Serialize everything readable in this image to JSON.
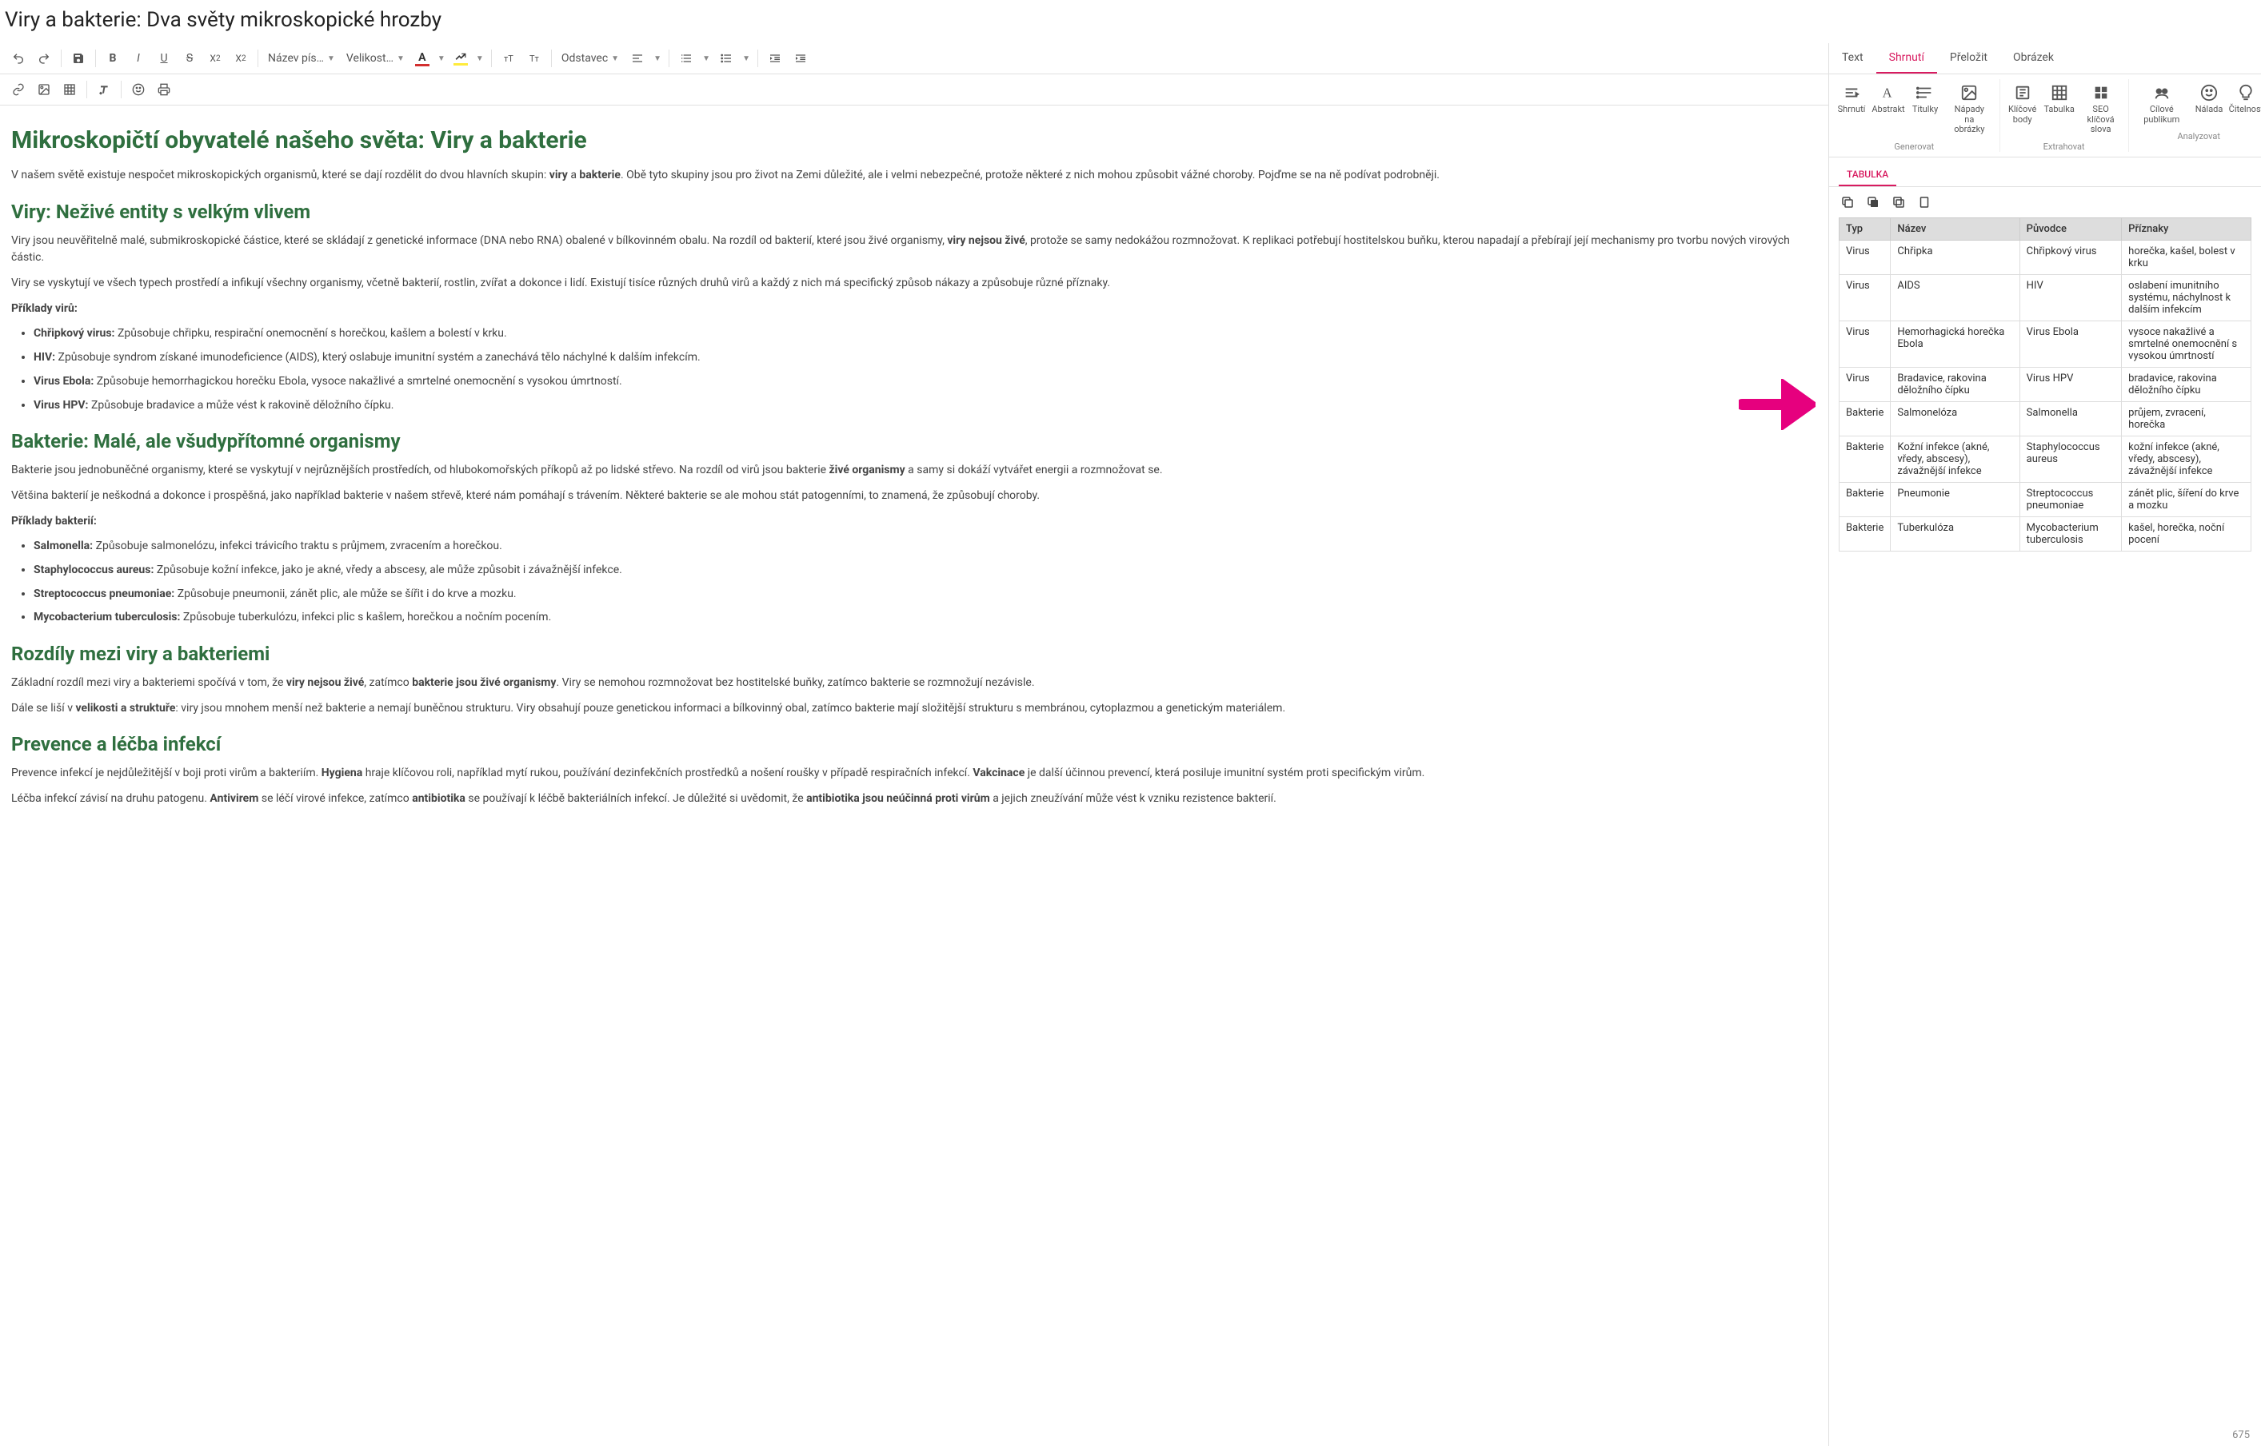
{
  "title": "Viry a bakterie: Dva světy mikroskopické hrozby",
  "toolbar": {
    "font_name": "Název pís…",
    "font_size": "Velikost…",
    "paragraph": "Odstavec"
  },
  "doc": {
    "h1": "Mikroskopičtí obyvatelé našeho světa: Viry a bakterie",
    "intro_1": "V našem světě existuje nespočet mikroskopických organismů, které se dají rozdělit do dvou hlavních skupin: ",
    "intro_b1": "viry",
    "intro_2": " a ",
    "intro_b2": "bakterie",
    "intro_3": ". Obě tyto skupiny jsou pro život na Zemi důležité, ale i velmi nebezpečné, protože některé z nich mohou způsobit vážné choroby. Pojďme se na ně podívat podrobněji.",
    "h2_viry": "Viry: Neživé entity s velkým vlivem",
    "viry_p1a": "Viry jsou neuvěřitelně malé, submikroskopické částice, které se skládají z genetické informace (DNA nebo RNA) obalené v bílkovinném obalu. Na rozdíl od bakterií, které jsou živé organismy, ",
    "viry_p1b": "viry nejsou živé",
    "viry_p1c": ", protože se samy nedokážou rozmnožovat. K replikaci potřebují hostitelskou buňku, kterou napadají a přebírají její mechanismy pro tvorbu nových virových částic.",
    "viry_p2": "Viry se vyskytují ve všech typech prostředí a infikují všechny organismy, včetně bakterií, rostlin, zvířat a dokonce i lidí. Existují tisíce různých druhů virů a každý z nich má specifický způsob nákazy a způsobuje různé příznaky.",
    "viry_ex_label": "Příklady virů:",
    "viry_list": [
      {
        "b": "Chřipkový virus:",
        "t": " Způsobuje chřipku, respirační onemocnění s horečkou, kašlem a bolestí v krku."
      },
      {
        "b": "HIV:",
        "t": " Způsobuje syndrom získané imunodeficience (AIDS), který oslabuje imunitní systém a zanechává tělo náchylné k dalším infekcím."
      },
      {
        "b": "Virus Ebola:",
        "t": " Způsobuje hemorrhagickou horečku Ebola, vysoce nakažlivé a smrtelné onemocnění s vysokou úmrtností."
      },
      {
        "b": "Virus HPV:",
        "t": " Způsobuje bradavice a může vést k rakovině děložního čípku."
      }
    ],
    "h2_bakt": "Bakterie: Malé, ale všudypřítomné organismy",
    "bakt_p1a": "Bakterie jsou jednobuněčné organismy, které se vyskytují v nejrůznějších prostředích, od hlubokomořských příkopů až po lidské střevo. Na rozdíl od virů jsou bakterie ",
    "bakt_p1b": "živé organismy",
    "bakt_p1c": " a samy si dokáží vytvářet energii a rozmnožovat se.",
    "bakt_p2": "Většina bakterií je neškodná a dokonce i prospěšná, jako například bakterie v našem střevě, které nám pomáhají s trávením. Některé bakterie se ale mohou stát patogenními, to znamená, že způsobují choroby.",
    "bakt_ex_label": "Příklady bakterií:",
    "bakt_list": [
      {
        "b": "Salmonella:",
        "t": " Způsobuje salmonelózu, infekci trávicího traktu s průjmem, zvracením a horečkou."
      },
      {
        "b": "Staphylococcus aureus:",
        "t": " Způsobuje kožní infekce, jako je akné, vředy a abscesy, ale může způsobit i závažnější infekce."
      },
      {
        "b": "Streptococcus pneumoniae:",
        "t": " Způsobuje pneumonii, zánět plic, ale může se šířit i do krve a mozku."
      },
      {
        "b": "Mycobacterium tuberculosis:",
        "t": " Způsobuje tuberkulózu, infekci plic s kašlem, horečkou a nočním pocením."
      }
    ],
    "h2_rozdily": "Rozdíly mezi viry a bakteriemi",
    "roz_p1a": "Základní rozdíl mezi viry a bakteriemi spočívá v tom, že ",
    "roz_p1b": "viry nejsou živé",
    "roz_p1c": ", zatímco ",
    "roz_p1d": "bakterie jsou živé organismy",
    "roz_p1e": ". Viry se nemohou rozmnožovat bez hostitelské buňky, zatímco bakterie se rozmnožují nezávisle.",
    "roz_p2a": "Dále se liší v ",
    "roz_p2b": "velikosti a struktuře",
    "roz_p2c": ": viry jsou mnohem menší než bakterie a nemají buněčnou strukturu. Viry obsahují pouze genetickou informaci a bílkovinný obal, zatímco bakterie mají složitější strukturu s membránou, cytoplazmou a genetickým materiálem.",
    "h2_prev": "Prevence a léčba infekcí",
    "prev_p1a": "Prevence infekcí je nejdůležitější v boji proti virům a bakteriím. ",
    "prev_p1b": "Hygiena",
    "prev_p1c": " hraje klíčovou roli, například mytí rukou, používání dezinfekčních prostředků a nošení roušky v případě respiračních infekcí. ",
    "prev_p1d": "Vakcinace",
    "prev_p1e": " je další účinnou prevencí, která posiluje imunitní systém proti specifickým virům.",
    "prev_p2a": "Léčba infekcí závisí na druhu patogenu. ",
    "prev_p2b": "Antivirem",
    "prev_p2c": " se léčí virové infekce, zatímco ",
    "prev_p2d": "antibiotika",
    "prev_p2e": " se používají k léčbě bakteriálních infekcí. Je důležité si uvědomit, že ",
    "prev_p2f": "antibiotika jsou neúčinná proti virům",
    "prev_p2g": " a jejich zneužívání může vést k vzniku rezistence bakterií."
  },
  "side": {
    "tabs": [
      "Text",
      "Shrnutí",
      "Přeložit",
      "Obrázek"
    ],
    "active_tab": 1,
    "ribbon": {
      "generate": {
        "caption": "Generovat",
        "items": [
          "Shrnutí",
          "Abstrakt",
          "Titulky",
          "Nápady na obrázky"
        ]
      },
      "extract": {
        "caption": "Extrahovat",
        "items": [
          "Klíčové body",
          "Tabulka",
          "SEO klíčová slova"
        ]
      },
      "analyze": {
        "caption": "Analyzovat",
        "items": [
          "Cílové publikum",
          "Nálada",
          "Čitelnost"
        ]
      }
    },
    "sub_tab": "TABULKA",
    "table": {
      "headers": [
        "Typ",
        "Název",
        "Původce",
        "Příznaky"
      ],
      "rows": [
        [
          "Virus",
          "Chřipka",
          "Chřipkový virus",
          "horečka, kašel, bolest v krku"
        ],
        [
          "Virus",
          "AIDS",
          "HIV",
          "oslabení imunitního systému, náchylnost k dalším infekcím"
        ],
        [
          "Virus",
          "Hemorhagická horečka Ebola",
          "Virus Ebola",
          "vysoce nakažlivé a smrtelné onemocnění s vysokou úmrtností"
        ],
        [
          "Virus",
          "Bradavice, rakovina děložního čípku",
          "Virus HPV",
          "bradavice, rakovina děložního čípku"
        ],
        [
          "Bakterie",
          "Salmonelóza",
          "Salmonella",
          "průjem, zvracení, horečka"
        ],
        [
          "Bakterie",
          "Kožní infekce (akné, vředy, abscesy), závažnější infekce",
          "Staphylococcus aureus",
          "kožní infekce (akné, vředy, abscesy), závažnější infekce"
        ],
        [
          "Bakterie",
          "Pneumonie",
          "Streptococcus pneumoniae",
          "zánět plic, šíření do krve a mozku"
        ],
        [
          "Bakterie",
          "Tuberkulóza",
          "Mycobacterium tuberculosis",
          "kašel, horečka, noční pocení"
        ]
      ]
    },
    "count": "675"
  }
}
